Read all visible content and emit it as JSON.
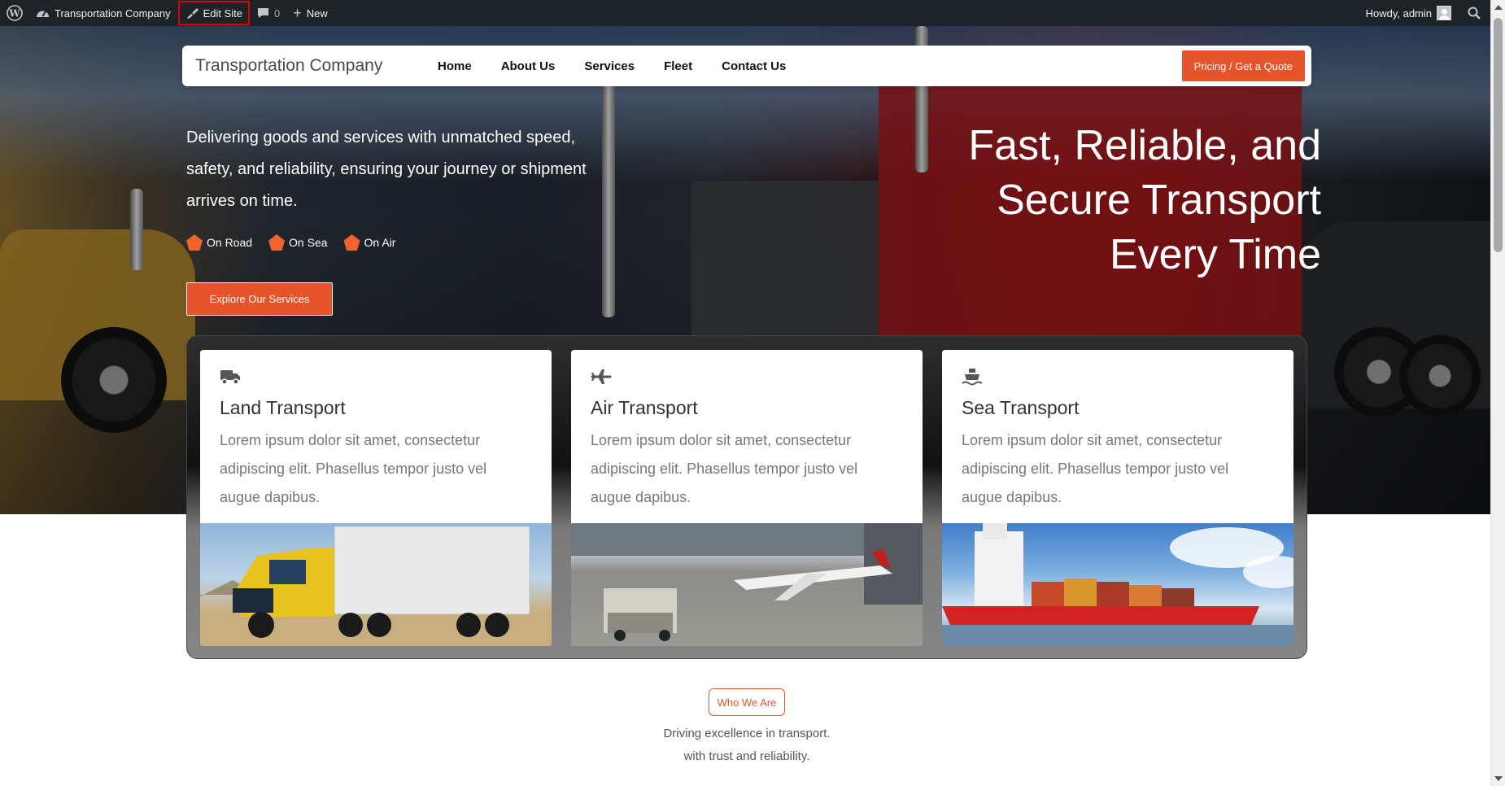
{
  "adminbar": {
    "site_name": "Transportation Company",
    "edit_site": "Edit Site",
    "comments_count": "0",
    "new_label": "New",
    "howdy": "Howdy, admin"
  },
  "nav": {
    "site_title": "Transportation Company",
    "menu": [
      "Home",
      "About Us",
      "Services",
      "Fleet",
      "Contact Us"
    ],
    "cta": "Pricing / Get a Quote"
  },
  "hero": {
    "description": "Delivering goods and services with unmatched speed, safety, and reliability, ensuring your journey or shipment arrives on time.",
    "tags": [
      "On Road",
      "On Sea",
      "On Air"
    ],
    "button": "Explore Our Services",
    "heading_lines": [
      "Fast, Reliable, and",
      "Secure Transport",
      "Every Time"
    ]
  },
  "cards": [
    {
      "icon": "truck-icon",
      "title": "Land Transport",
      "text": "Lorem ipsum dolor sit amet, consectetur adipiscing elit. Phasellus tempor justo vel augue dapibus."
    },
    {
      "icon": "plane-icon",
      "title": "Air Transport",
      "text": "Lorem ipsum dolor sit amet, consectetur adipiscing elit. Phasellus tempor justo vel augue dapibus."
    },
    {
      "icon": "ship-icon",
      "title": "Sea Transport",
      "text": "Lorem ipsum dolor sit amet, consectetur adipiscing elit. Phasellus tempor justo vel augue dapibus."
    }
  ],
  "about": {
    "badge": "Who We Are",
    "line1": "Driving excellence in transport.",
    "line2": "with trust and reliability."
  },
  "colors": {
    "accent": "#e5542a",
    "adminbar": "#1d2327",
    "highlight": "#e00000"
  }
}
